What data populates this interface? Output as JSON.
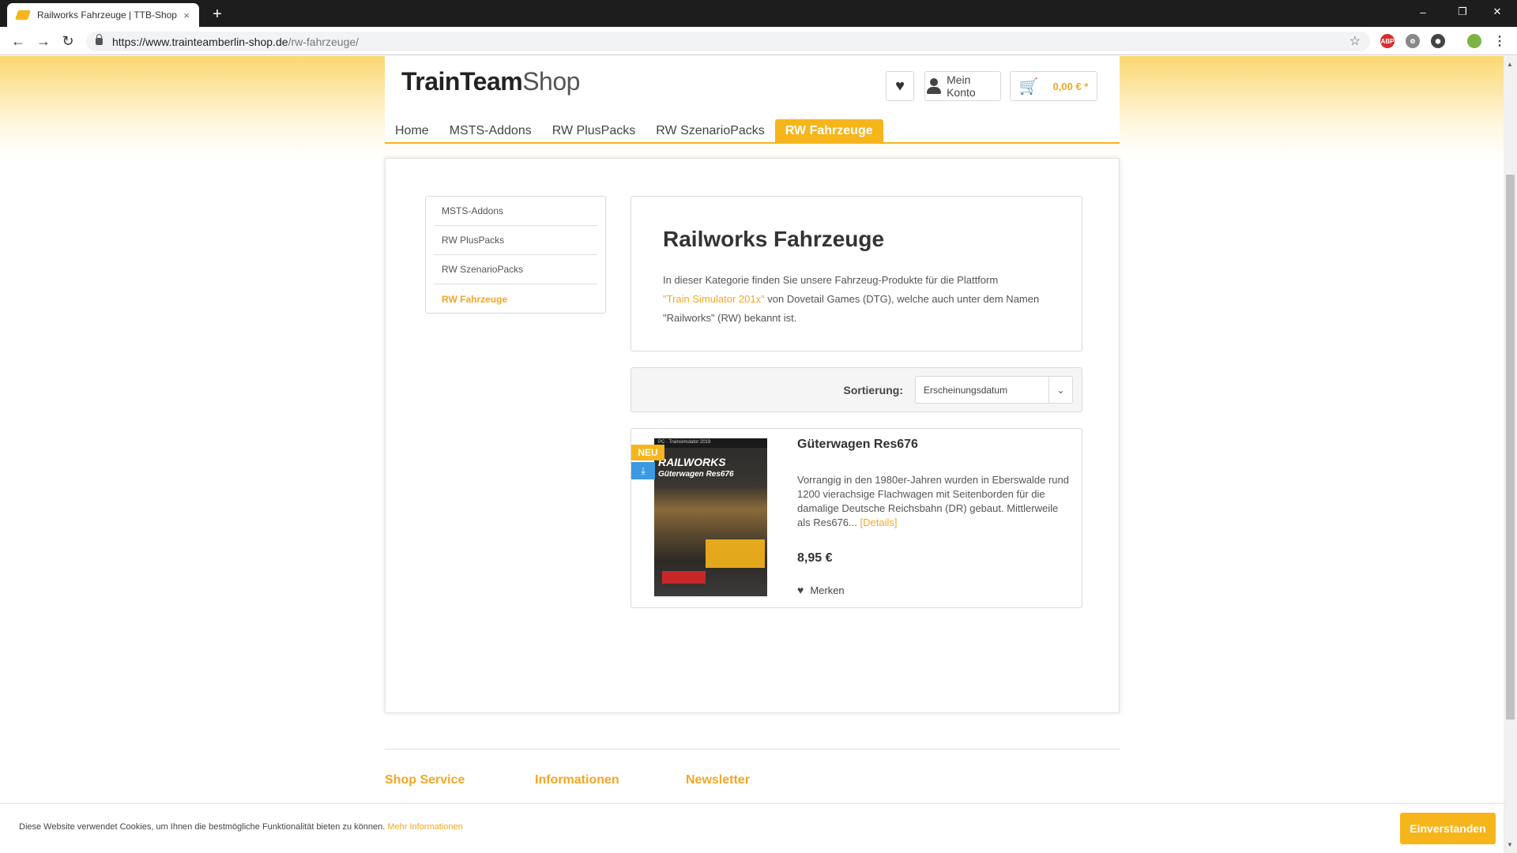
{
  "browser": {
    "tab_title": "Railworks Fahrzeuge | TTB-Shop",
    "tab_close": "×",
    "new_tab": "+",
    "url_host": "https://www.trainteamberlin-shop.de",
    "url_path": "/rw-fahrzeuge/",
    "window_controls": [
      "–",
      "❐",
      "✕"
    ],
    "extensions": [
      {
        "name": "adblock-icon",
        "label": "ABP",
        "color": "#d32f2f"
      },
      {
        "name": "extension-icon",
        "label": "⚙",
        "color": "#666666"
      },
      {
        "name": "cube-icon",
        "label": "⬢",
        "color": "#444444"
      },
      {
        "name": "profile-avatar-icon",
        "label": "",
        "color": "#7cb342"
      }
    ],
    "menu_icon": "⋮"
  },
  "header": {
    "logo_bold": "TrainTeam",
    "logo_light": "Shop",
    "account_label": "Mein Konto",
    "cart_total": "0,00 € *"
  },
  "nav": {
    "items": [
      {
        "label": "Home",
        "active": false
      },
      {
        "label": "MSTS-Addons",
        "active": false
      },
      {
        "label": "RW PlusPacks",
        "active": false
      },
      {
        "label": "RW SzenarioPacks",
        "active": false
      },
      {
        "label": "RW Fahrzeuge",
        "active": true
      }
    ]
  },
  "sidebar": {
    "items": [
      {
        "label": "MSTS-Addons",
        "active": false
      },
      {
        "label": "RW PlusPacks",
        "active": false
      },
      {
        "label": "RW SzenarioPacks",
        "active": false
      },
      {
        "label": "RW Fahrzeuge",
        "active": true
      }
    ]
  },
  "category": {
    "title": "Railworks Fahrzeuge",
    "desc_part1": "In dieser Kategorie finden Sie unsere Fahrzeug-Produkte für die Plattform",
    "desc_highlight": "\"Train Simulator 201x\"",
    "desc_part2": " von Dovetail Games (DTG), welche auch unter dem Namen \"Railworks\" (RW) bekannt ist."
  },
  "sort": {
    "label": "Sortierung:",
    "selected": "Erscheinungsdatum"
  },
  "product": {
    "title": "Güterwagen Res676",
    "badge_new": "NEU",
    "image_top": "PC · Trainsimulator 2019",
    "image_title": "RAILWORKS",
    "image_subtitle": "Güterwagen Res676",
    "description": "Vorrangig in den 1980er-Jahren wurden in Eberswalde rund 1200 vierachsige Flachwagen mit Seitenborden für die damalige Deutsche Reichsbahn (DR) gebaut. Mittlerweile als Res676... ",
    "details_link": "[Details]",
    "price": "8,95 €",
    "merken_label": "Merken"
  },
  "footer": {
    "headings": [
      "Shop Service",
      "Informationen",
      "Newsletter"
    ]
  },
  "cookie": {
    "text": "Diese Website verwendet Cookies, um Ihnen die bestmögliche Funktionalität bieten zu können. ",
    "link": "Mehr Informationen",
    "button": "Einverstanden"
  },
  "colors": {
    "accent": "#f7b51c",
    "accent_text": "#f5a623"
  }
}
